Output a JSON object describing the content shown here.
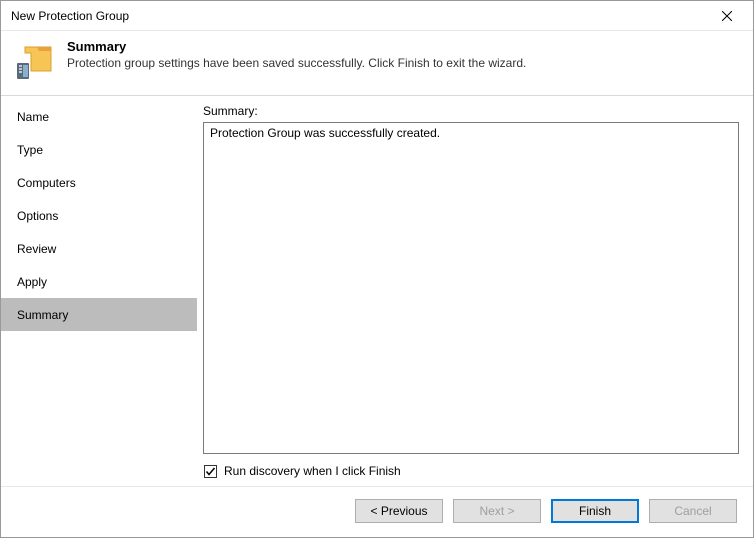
{
  "window": {
    "title": "New Protection Group"
  },
  "header": {
    "title": "Summary",
    "description": "Protection group settings have been saved successfully. Click Finish to exit the wizard."
  },
  "sidebar": {
    "items": [
      {
        "label": "Name"
      },
      {
        "label": "Type"
      },
      {
        "label": "Computers"
      },
      {
        "label": "Options"
      },
      {
        "label": "Review"
      },
      {
        "label": "Apply"
      },
      {
        "label": "Summary"
      }
    ]
  },
  "main": {
    "summary_label": "Summary:",
    "summary_text": "Protection Group was successfully created.",
    "checkbox_label": "Run discovery when I click Finish",
    "checkbox_checked": true
  },
  "buttons": {
    "previous": "< Previous",
    "next": "Next >",
    "finish": "Finish",
    "cancel": "Cancel"
  }
}
